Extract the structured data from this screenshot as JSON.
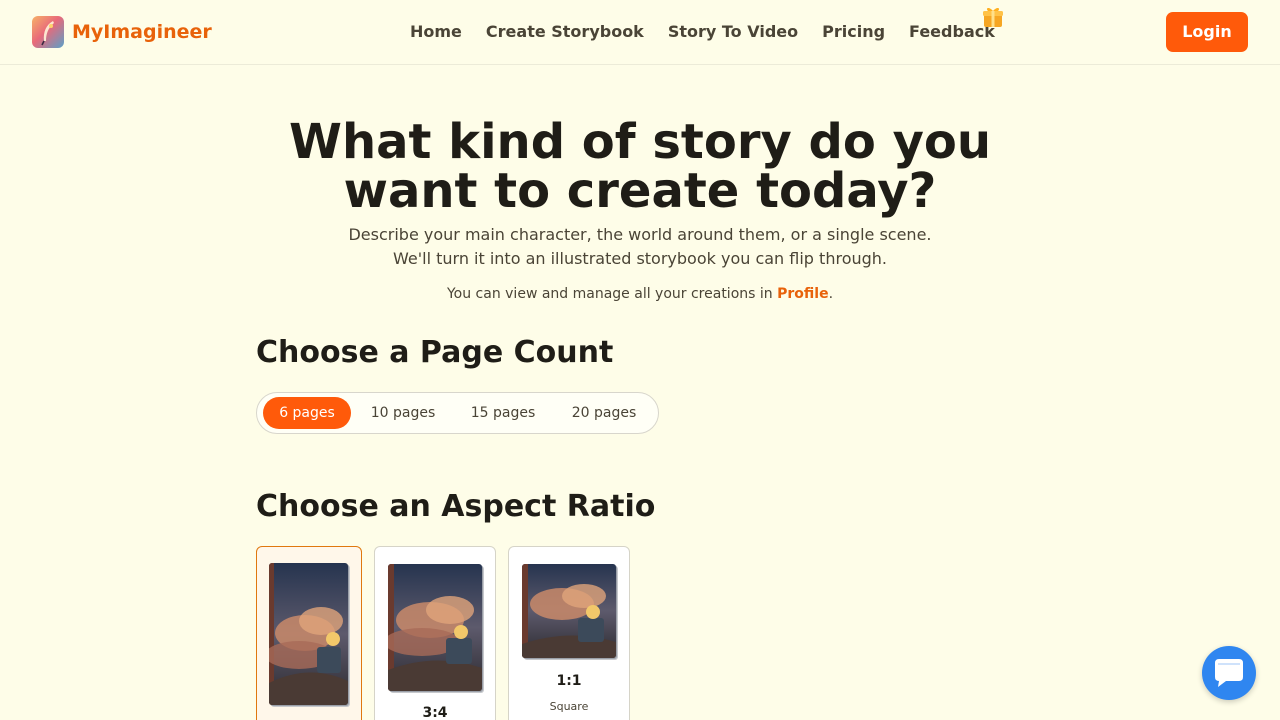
{
  "brand": {
    "name": "MyImagineer",
    "logo_icon": "quill-feather-icon"
  },
  "nav": {
    "items": [
      {
        "label": "Home"
      },
      {
        "label": "Create Storybook"
      },
      {
        "label": "Story To Video"
      },
      {
        "label": "Pricing"
      },
      {
        "label": "Feedback"
      }
    ],
    "feedback_badge_icon": "gift-icon"
  },
  "login": {
    "label": "Login"
  },
  "hero": {
    "title": "What kind of story do you want to create today?",
    "description": "Describe your main character, the world around them, or a single scene. We'll turn it into an illustrated storybook you can flip through.",
    "note_prefix": "You can view and manage all your creations in ",
    "note_link": "Profile",
    "note_suffix": "."
  },
  "page_count": {
    "title": "Choose a Page Count",
    "options": [
      "6 pages",
      "10 pages",
      "15 pages",
      "20 pages"
    ],
    "selected": "6 pages"
  },
  "aspect_ratio": {
    "title": "Choose an Aspect Ratio",
    "options": [
      {
        "label": "",
        "sub": "",
        "selected": true
      },
      {
        "label": "3:4",
        "sub": "",
        "selected": false
      },
      {
        "label": "1:1",
        "sub": "Square",
        "selected": false
      }
    ]
  },
  "chat": {
    "icon": "chat-bubble-icon"
  },
  "colors": {
    "accent": "#ff5a0a",
    "brand_text": "#e8620a",
    "background": "#fefde8",
    "chat": "#2f86f0"
  }
}
